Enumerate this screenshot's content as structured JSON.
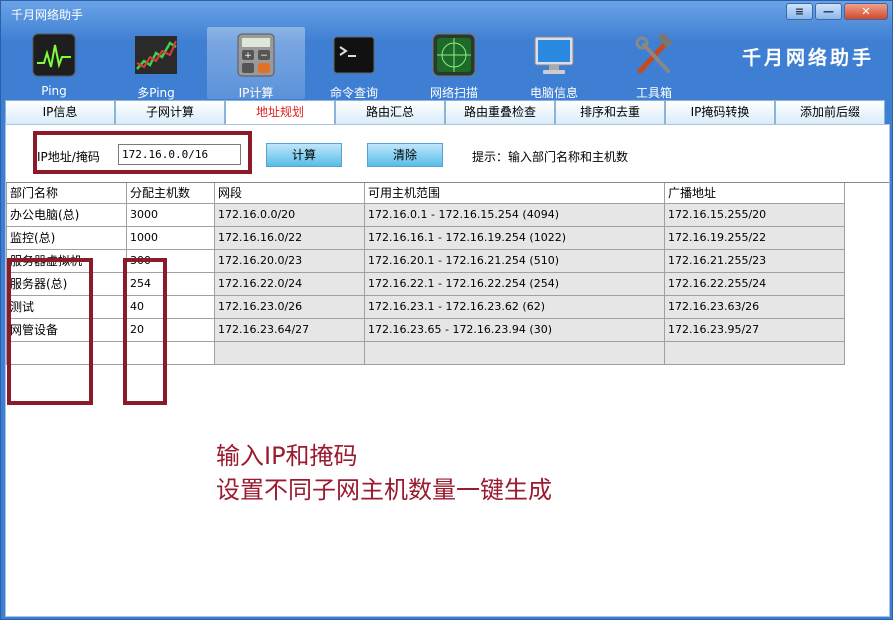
{
  "window": {
    "title": "千月网络助手",
    "brand": "千月网络助手"
  },
  "titlebar_buttons": {
    "menu": "≡",
    "minimize": "—",
    "close": "✕"
  },
  "toolbar": [
    {
      "label": "Ping",
      "icon": "ping-monitor-icon"
    },
    {
      "label": "多Ping",
      "icon": "stock-chart-icon"
    },
    {
      "label": "IP计算",
      "icon": "calculator-icon"
    },
    {
      "label": "命令查询",
      "icon": "terminal-icon"
    },
    {
      "label": "网络扫描",
      "icon": "radar-icon"
    },
    {
      "label": "电脑信息",
      "icon": "computer-monitor-icon"
    },
    {
      "label": "工具箱",
      "icon": "tools-icon"
    }
  ],
  "tabs": [
    {
      "label": "IP信息"
    },
    {
      "label": "子网计算"
    },
    {
      "label": "地址规划"
    },
    {
      "label": "路由汇总"
    },
    {
      "label": "路由重叠检查"
    },
    {
      "label": "排序和去重"
    },
    {
      "label": "IP掩码转换"
    },
    {
      "label": "添加前后缀"
    }
  ],
  "form": {
    "ip_label": "IP地址/掩码",
    "ip_value": "172.16.0.0/16",
    "calc_label": "计算",
    "clear_label": "清除",
    "hint": "提示：输入部门名称和主机数"
  },
  "table": {
    "headers": [
      "部门名称",
      "分配主机数",
      "网段",
      "可用主机范围",
      "广播地址"
    ],
    "rows": [
      [
        "办公电脑(总)",
        "3000",
        "172.16.0.0/20",
        "172.16.0.1 - 172.16.15.254 (4094)",
        "172.16.15.255/20"
      ],
      [
        "监控(总)",
        "1000",
        "172.16.16.0/22",
        "172.16.16.1 - 172.16.19.254 (1022)",
        "172.16.19.255/22"
      ],
      [
        "服务器虚拟机",
        "300",
        "172.16.20.0/23",
        "172.16.20.1 - 172.16.21.254 (510)",
        "172.16.21.255/23"
      ],
      [
        "服务器(总)",
        "254",
        "172.16.22.0/24",
        "172.16.22.1 - 172.16.22.254 (254)",
        "172.16.22.255/24"
      ],
      [
        "测试",
        "40",
        "172.16.23.0/26",
        "172.16.23.1 - 172.16.23.62 (62)",
        "172.16.23.63/26"
      ],
      [
        "网管设备",
        "20",
        "172.16.23.64/27",
        "172.16.23.65 - 172.16.23.94 (30)",
        "172.16.23.95/27"
      ],
      [
        "",
        "",
        "",
        "",
        ""
      ]
    ]
  },
  "annotation": {
    "line1": "输入IP和掩码",
    "line2": "设置不同子网主机数量一键生成"
  },
  "colors": {
    "accent_red": "#8b1a2a",
    "titlebar_blue": "#3f7fd3",
    "active_tab_text": "#e02020"
  }
}
